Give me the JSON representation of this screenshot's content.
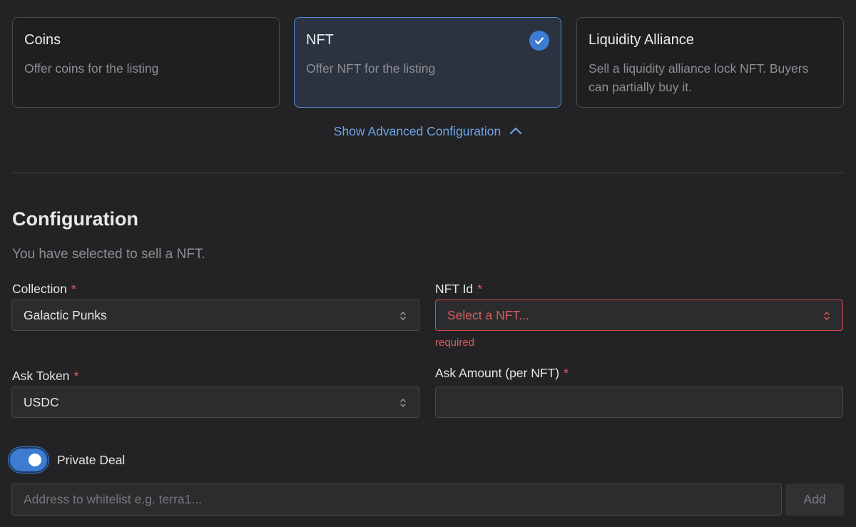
{
  "listing_types": [
    {
      "title": "Coins",
      "description": "Offer coins for the listing",
      "selected": false
    },
    {
      "title": "NFT",
      "description": "Offer NFT for the listing",
      "selected": true
    },
    {
      "title": "Liquidity Alliance",
      "description": "Sell a liquidity alliance lock NFT. Buyers can partially buy it.",
      "selected": false
    }
  ],
  "advanced_toggle": {
    "label": "Show Advanced Configuration",
    "icon": "chevron-up-icon"
  },
  "configuration": {
    "title": "Configuration",
    "subtitle": "You have selected to sell a NFT."
  },
  "fields": {
    "collection": {
      "label": "Collection",
      "required_mark": "*",
      "value": "Galactic Punks"
    },
    "nft_id": {
      "label": "NFT Id",
      "required_mark": "*",
      "value": "Select a NFT...",
      "error": "required"
    },
    "ask_token": {
      "label": "Ask Token",
      "required_mark": "*",
      "value": "USDC"
    },
    "ask_amount": {
      "label": "Ask Amount (per NFT)",
      "required_mark": "*",
      "value": ""
    }
  },
  "private_deal": {
    "label": "Private Deal",
    "enabled": true
  },
  "whitelist": {
    "placeholder": "Address to whitelist e.g. terra1...",
    "value": "",
    "add_label": "Add"
  },
  "colors": {
    "background": "#232325",
    "accent": "#3e7bd2",
    "link": "#6ea4e6",
    "error": "#d95c5c"
  }
}
